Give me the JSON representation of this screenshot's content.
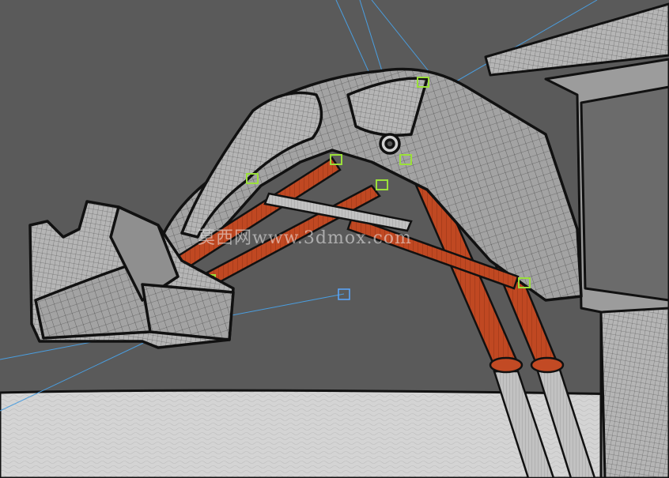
{
  "scene": {
    "watermark": "莫西网www.3dmox.com",
    "colors": {
      "background": "#5a5a5a",
      "ground": "#d9d9d9",
      "arm_shell": "#9a9a9a",
      "cylinder": "#c24a24",
      "rod": "#bdbdbd",
      "helper_line": "#4a9ee0",
      "gizmo": "#9be03a",
      "outline": "#111111"
    }
  }
}
